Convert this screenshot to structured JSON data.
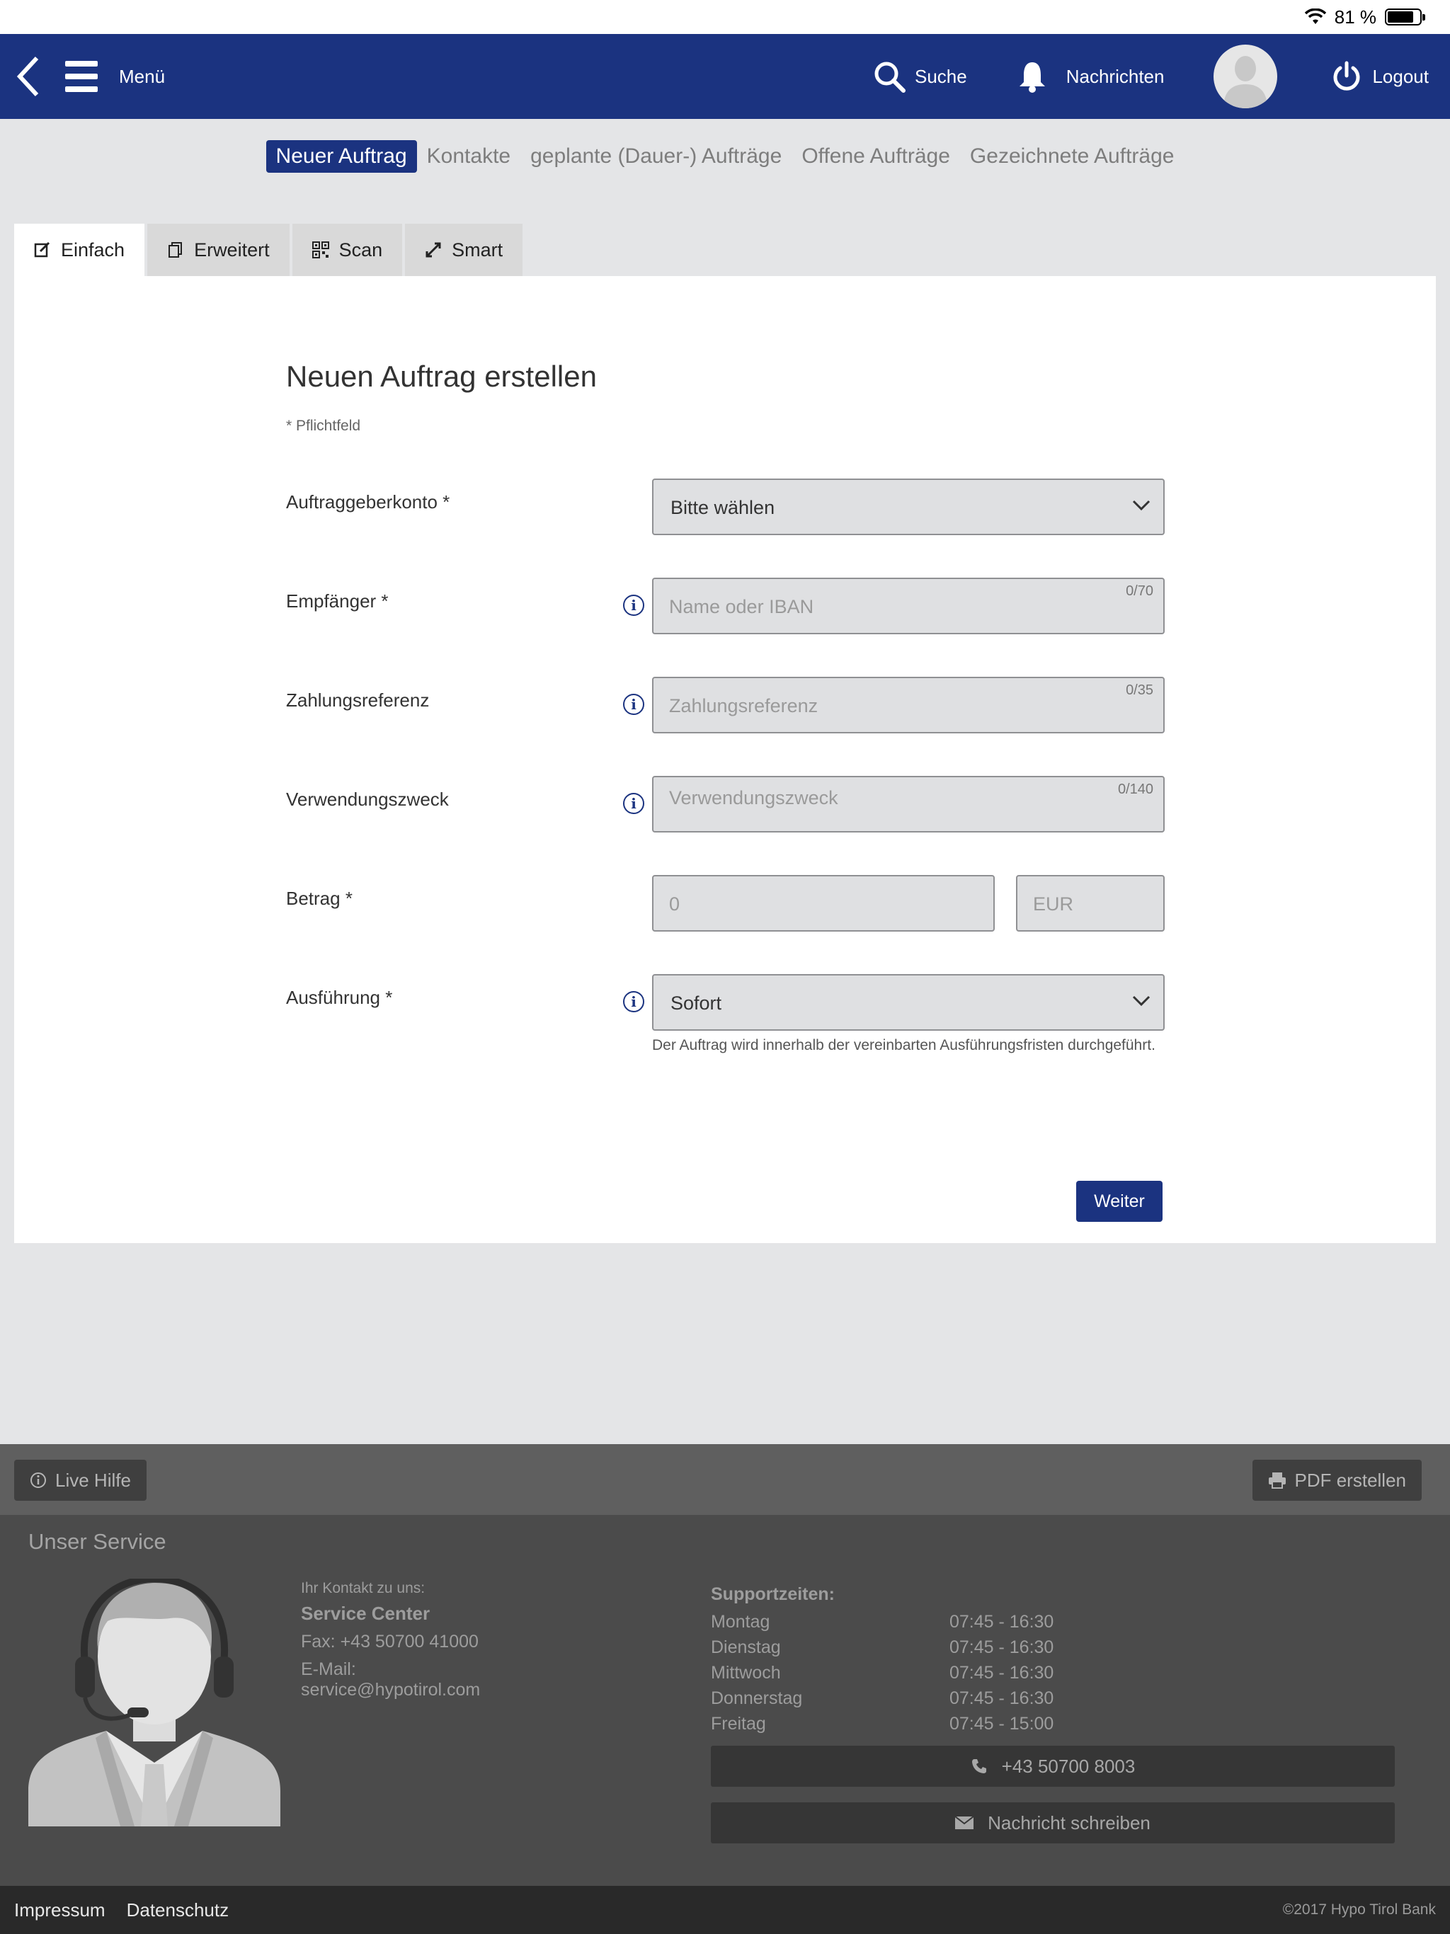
{
  "status_bar": {
    "battery": "81 %",
    "battery_level": 0.81
  },
  "header": {
    "menu_label": "Menü",
    "search_label": "Suche",
    "messages_label": "Nachrichten",
    "logout_label": "Logout"
  },
  "subnav": {
    "items": [
      {
        "label": "Neuer Auftrag",
        "active": true
      },
      {
        "label": "Kontakte",
        "active": false
      },
      {
        "label": "geplante (Dauer-) Aufträge",
        "active": false
      },
      {
        "label": "Offene Aufträge",
        "active": false
      },
      {
        "label": "Gezeichnete Aufträge",
        "active": false
      }
    ]
  },
  "tabs": [
    {
      "label": "Einfach",
      "icon": "edit-icon",
      "active": true
    },
    {
      "label": "Erweitert",
      "icon": "copy-icon",
      "active": false
    },
    {
      "label": "Scan",
      "icon": "qr-code-icon",
      "active": false
    },
    {
      "label": "Smart",
      "icon": "smart-arrows-icon",
      "active": false
    }
  ],
  "form": {
    "title": "Neuen Auftrag erstellen",
    "required_note": "* Pflichtfeld",
    "account": {
      "label": "Auftraggeberkonto *",
      "value": "Bitte wählen"
    },
    "recipient": {
      "label": "Empfänger *",
      "placeholder": "Name oder IBAN",
      "counter": "0/70"
    },
    "reference": {
      "label": "Zahlungsreferenz",
      "placeholder": "Zahlungsreferenz",
      "counter": "0/35"
    },
    "purpose": {
      "label": "Verwendungszweck",
      "placeholder": "Verwendungszweck",
      "counter": "0/140"
    },
    "amount": {
      "label": "Betrag *",
      "placeholder": "0",
      "currency": "EUR"
    },
    "execution": {
      "label": "Ausführung *",
      "value": "Sofort",
      "hint": "Der Auftrag wird innerhalb der vereinbarten Ausführungsfristen durchgeführt."
    },
    "submit_label": "Weiter"
  },
  "toolbar": {
    "live_help": "Live Hilfe",
    "pdf": "PDF erstellen"
  },
  "service": {
    "title": "Unser Service",
    "contact_intro": "Ihr Kontakt zu uns:",
    "center_name": "Service Center",
    "fax": "Fax: +43 50700 41000",
    "email_label": "E-Mail:",
    "email": "service@hypotirol.com",
    "hours_title": "Supportzeiten:",
    "hours": [
      {
        "day": "Montag",
        "time": "07:45 - 16:30"
      },
      {
        "day": "Dienstag",
        "time": "07:45 - 16:30"
      },
      {
        "day": "Mittwoch",
        "time": "07:45 - 16:30"
      },
      {
        "day": "Donnerstag",
        "time": "07:45 - 16:30"
      },
      {
        "day": "Freitag",
        "time": "07:45 - 15:00"
      }
    ],
    "phone_button": "+43 50700 8003",
    "message_button": "Nachricht schreiben"
  },
  "bottom": {
    "impressum": "Impressum",
    "privacy": "Datenschutz",
    "copyright": "©2017 Hypo Tirol Bank"
  }
}
